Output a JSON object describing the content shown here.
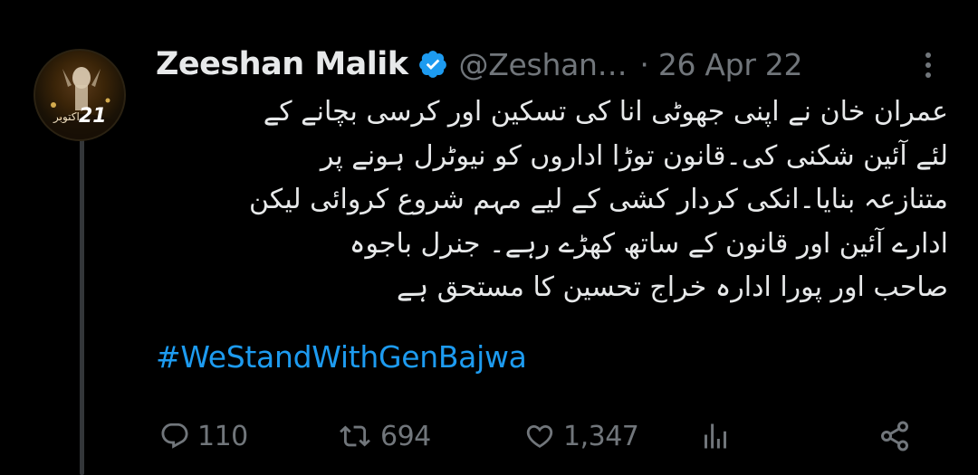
{
  "tweet": {
    "author": {
      "display_name": "Zeeshan Malik",
      "handle": "@Zeshan…",
      "verified": true,
      "avatar_badge": "21",
      "avatar_caption": "اکتوبر"
    },
    "separator": "·",
    "date": "26 Apr 22",
    "text_lines": [
      "عمران خان نے اپنی جھوٹی انا کی تسکین اور کرسی بچانے کے",
      "لئے آئین شکنی کی۔قانون توڑا اداروں کو نیوٹرل ہونے پر",
      "متنازعہ بنایا۔انکی کردار کشی کے لیے مہم شروع کروائی لیکن",
      "ادارے آئین اور قانون کے ساتھ کھڑے رہے۔ جنرل باجوہ",
      "صاحب اور پورا ادارہ خراج تحسین کا مستحق ہے"
    ],
    "hashtag": "#WeStandWithGenBajwa",
    "actions": {
      "replies": "110",
      "retweets": "694",
      "likes": "1,347"
    }
  },
  "icons": {
    "verified": "verified-badge-icon",
    "more": "more-options-icon",
    "reply": "reply-icon",
    "retweet": "retweet-icon",
    "like": "heart-icon",
    "analytics": "analytics-icon",
    "share": "share-icon"
  },
  "colors": {
    "background": "#000000",
    "text": "#e7e9ea",
    "secondary": "#71767b",
    "accent": "#1d9bf0",
    "thread_line": "#333639"
  }
}
